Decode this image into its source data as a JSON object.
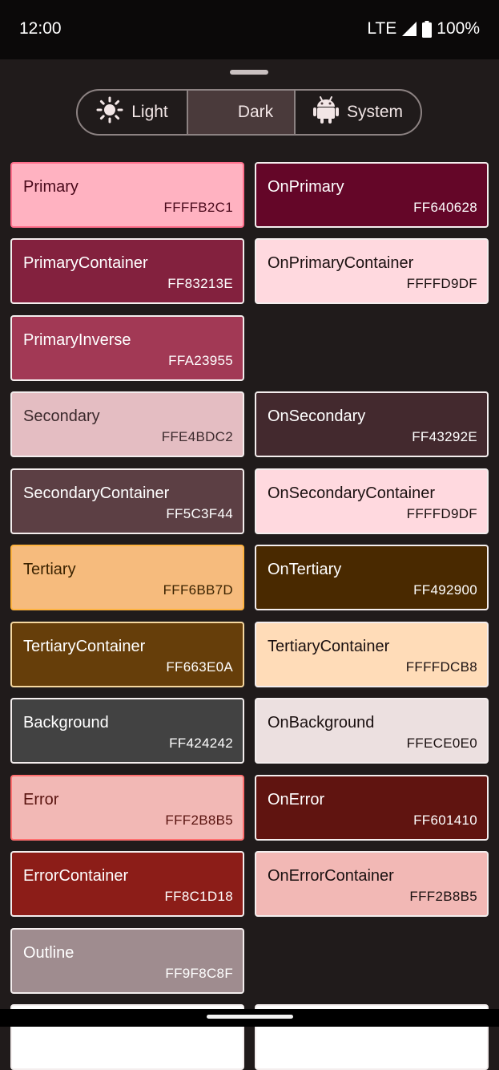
{
  "status": {
    "time": "12:00",
    "network": "LTE",
    "battery": "100%"
  },
  "theme_selector": {
    "light": "Light",
    "dark": "Dark",
    "system": "System",
    "selected": "Dark"
  },
  "swatches": [
    {
      "name": "Primary",
      "hex": "FFFFB2C1",
      "bg": "#ffb2c1",
      "fg": "#4a0a1c",
      "border": "#ff6f8c"
    },
    {
      "name": "OnPrimary",
      "hex": "FF640628",
      "bg": "#640628",
      "fg": "#ffffff",
      "border": "#f4eeee"
    },
    {
      "name": "PrimaryContainer",
      "hex": "FF83213E",
      "bg": "#83213e",
      "fg": "#ffffff",
      "border": "#f4eeee"
    },
    {
      "name": "OnPrimaryContainer",
      "hex": "FFFFD9DF",
      "bg": "#ffd9df",
      "fg": "#1b1111",
      "border": "#f4eeee"
    },
    {
      "name": "PrimaryInverse",
      "hex": "FFA23955",
      "bg": "#a23955",
      "fg": "#ffffff",
      "border": "#f4eeee"
    },
    {
      "name": "Secondary",
      "hex": "FFE4BDC2",
      "bg": "#e4bdc2",
      "fg": "#3c2a2d",
      "border": "#f4eeee"
    },
    {
      "name": "OnSecondary",
      "hex": "FF43292E",
      "bg": "#43292e",
      "fg": "#ffffff",
      "border": "#f4eeee"
    },
    {
      "name": "SecondaryContainer",
      "hex": "FF5C3F44",
      "bg": "#5c3f44",
      "fg": "#ffffff",
      "border": "#f4eeee"
    },
    {
      "name": "OnSecondaryContainer",
      "hex": "FFFFD9DF",
      "bg": "#ffd9df",
      "fg": "#1b1111",
      "border": "#f4eeee"
    },
    {
      "name": "Tertiary",
      "hex": "FFF6BB7D",
      "bg": "#f6bb7d",
      "fg": "#3a2200",
      "border": "#ffb340"
    },
    {
      "name": "OnTertiary",
      "hex": "FF492900",
      "bg": "#492900",
      "fg": "#ffffff",
      "border": "#f4eeee"
    },
    {
      "name": "TertiaryContainer",
      "hex": "FF663E0A",
      "bg": "#663e0a",
      "fg": "#ffffff",
      "border": "#f6d8a0"
    },
    {
      "name": "TertiaryContainer",
      "hex": "FFFFDCB8",
      "bg": "#ffdcb8",
      "fg": "#1b1111",
      "border": "#f4eeee"
    },
    {
      "name": "Background",
      "hex": "FF424242",
      "bg": "#424242",
      "fg": "#ffffff",
      "border": "#f4eeee"
    },
    {
      "name": "OnBackground",
      "hex": "FFECE0E0",
      "bg": "#ece0e0",
      "fg": "#1b1111",
      "border": "#f4eeee"
    },
    {
      "name": "Error",
      "hex": "FFF2B8B5",
      "bg": "#f2b8b5",
      "fg": "#5a1410",
      "border": "#ff6f6f"
    },
    {
      "name": "OnError",
      "hex": "FF601410",
      "bg": "#601410",
      "fg": "#ffffff",
      "border": "#f4eeee"
    },
    {
      "name": "ErrorContainer",
      "hex": "FF8C1D18",
      "bg": "#8c1d18",
      "fg": "#ffffff",
      "border": "#f4eeee"
    },
    {
      "name": "OnErrorContainer",
      "hex": "FFF2B8B5",
      "bg": "#f2b8b5",
      "fg": "#1b1111",
      "border": "#f4eeee"
    },
    {
      "name": "Outline",
      "hex": "FF9F8C8F",
      "bg": "#9f8c8f",
      "fg": "#ffffff",
      "border": "#f4eeee"
    }
  ]
}
